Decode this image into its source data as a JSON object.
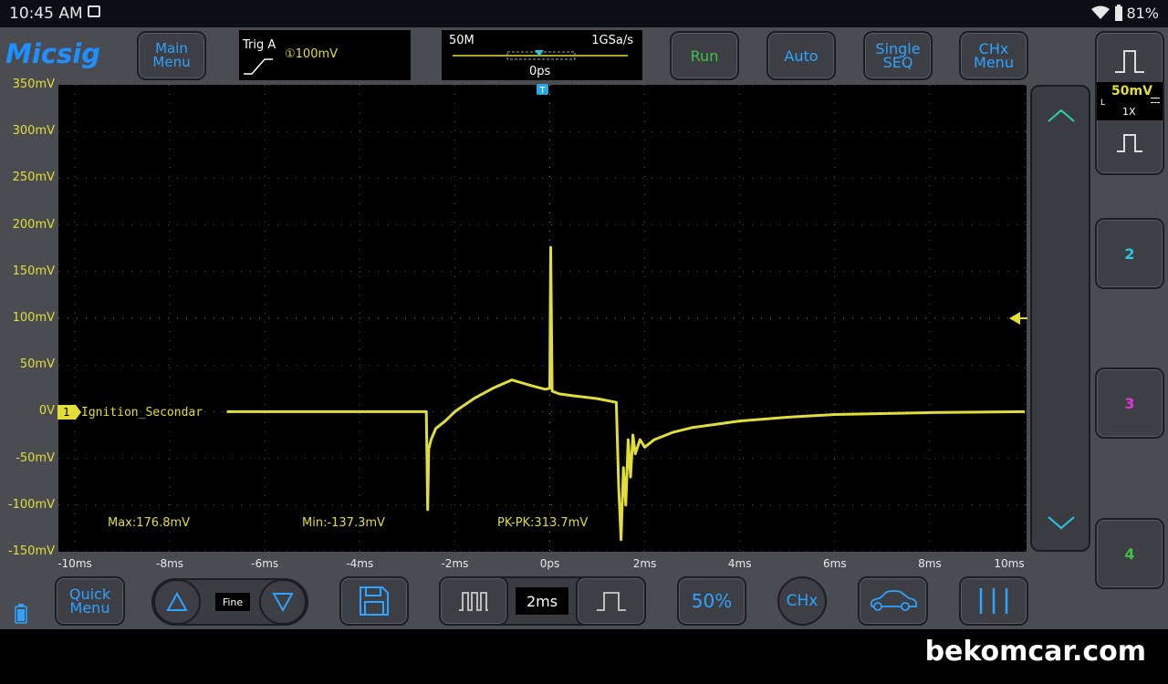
{
  "status": {
    "time": "10:45 AM",
    "battery": "81%"
  },
  "brand": "Micsig",
  "toolbar": {
    "main_menu": [
      "Main",
      "Menu"
    ],
    "run": "Run",
    "auto": "Auto",
    "single_seq": [
      "Single",
      "SEQ"
    ],
    "chx_menu": [
      "CHx",
      "Menu"
    ]
  },
  "trigger": {
    "label": "Trig A",
    "level": "①100mV"
  },
  "timebase": {
    "memory": "50M",
    "sample_rate": "1GSa/s",
    "position": "0ps"
  },
  "channel1": {
    "scale": "50mV",
    "coupling": "L",
    "probe": "1X",
    "marker": "1",
    "label": "Ignition_Secondar"
  },
  "channels": [
    "2",
    "3",
    "4"
  ],
  "y_labels": [
    "350mV",
    "300mV",
    "250mV",
    "200mV",
    "150mV",
    "100mV",
    "50mV",
    "0V",
    "-50mV",
    "-100mV",
    "-150mV"
  ],
  "x_labels": [
    "-10ms",
    "-8ms",
    "-6ms",
    "-4ms",
    "-2ms",
    "0ps",
    "2ms",
    "4ms",
    "6ms",
    "8ms",
    "10ms"
  ],
  "measurements": {
    "max": "Max:176.8mV",
    "min": "Min:-137.3mV",
    "pkpk": "PK-PK:313.7mV"
  },
  "bottom": {
    "quick_menu": [
      "Quick",
      "Menu"
    ],
    "fine": "Fine",
    "time_div": "2ms",
    "percent": "50%",
    "chx": "CHx"
  },
  "watermark": "bekomcar.com",
  "colors": {
    "ch1": "#e1de3a",
    "ch2": "#28c8e0",
    "ch3": "#d838d8",
    "ch4": "#3ec24a",
    "accent": "#2ea3ff"
  },
  "chart_data": {
    "type": "line",
    "x_unit": "ms",
    "y_unit": "mV",
    "xlim": [
      -10,
      10
    ],
    "ylim": [
      -150,
      350
    ],
    "series": [
      {
        "name": "Ignition_Secondar",
        "x": [
          -6.8,
          -2.6,
          -2.57,
          -2.55,
          -2.5,
          -2.4,
          -2.2,
          -2.0,
          -1.6,
          -1.2,
          -0.8,
          -0.4,
          -0.1,
          0.0,
          0.02,
          0.05,
          0.2,
          0.5,
          1.0,
          1.4,
          1.45,
          1.5,
          1.55,
          1.6,
          1.65,
          1.7,
          1.75,
          1.8,
          1.9,
          2.0,
          2.2,
          2.6,
          3.0,
          4.0,
          5.0,
          6.0,
          8.0,
          10.0
        ],
        "y": [
          0,
          0,
          -105,
          -40,
          -30,
          -18,
          -10,
          0,
          14,
          25,
          34,
          28,
          24,
          25,
          176,
          22,
          19,
          17,
          14,
          10,
          -80,
          -137,
          -60,
          -100,
          -30,
          -70,
          -25,
          -45,
          -30,
          -38,
          -30,
          -22,
          -17,
          -10,
          -6,
          -3,
          -1,
          0
        ]
      }
    ],
    "trigger_level": 100,
    "grid": true
  }
}
